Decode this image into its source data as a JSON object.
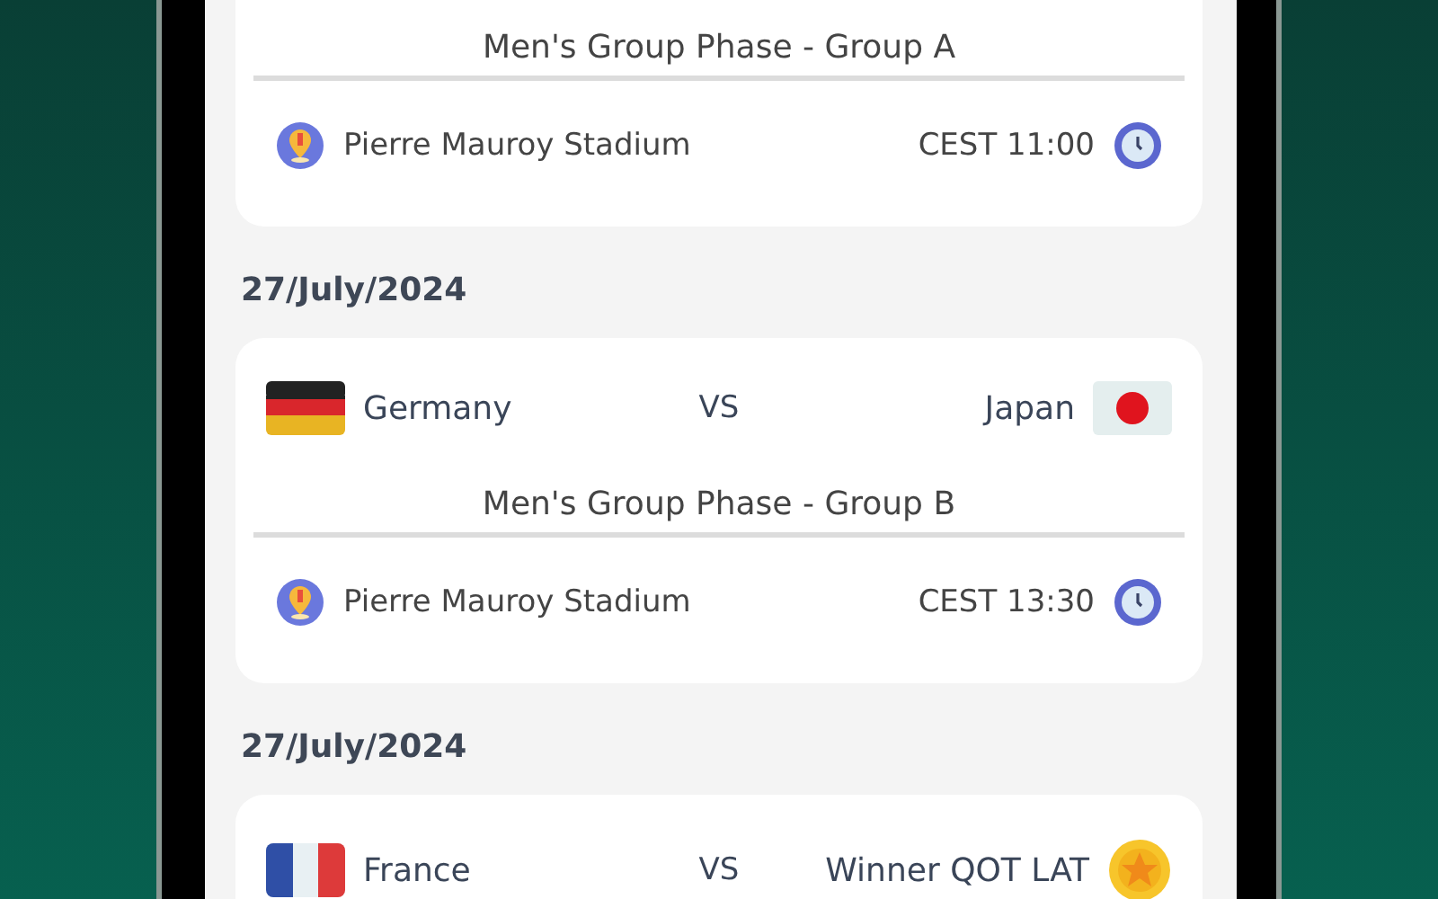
{
  "matches": [
    {
      "group": "Men's Group Phase - Group A",
      "venue": "Pierre Mauroy Stadium",
      "time": "CEST 11:00"
    },
    {
      "date": "27/July/2024",
      "home": {
        "name": "Germany",
        "kind": "germany"
      },
      "vs": "VS",
      "away": {
        "name": "Japan",
        "kind": "japan"
      },
      "group": "Men's Group Phase - Group B",
      "venue": "Pierre Mauroy Stadium",
      "time": "CEST 13:30"
    },
    {
      "date": "27/July/2024",
      "home": {
        "name": "France",
        "kind": "france"
      },
      "vs": "VS",
      "away": {
        "name": "Winner QOT LAT",
        "kind": "medal"
      }
    }
  ]
}
